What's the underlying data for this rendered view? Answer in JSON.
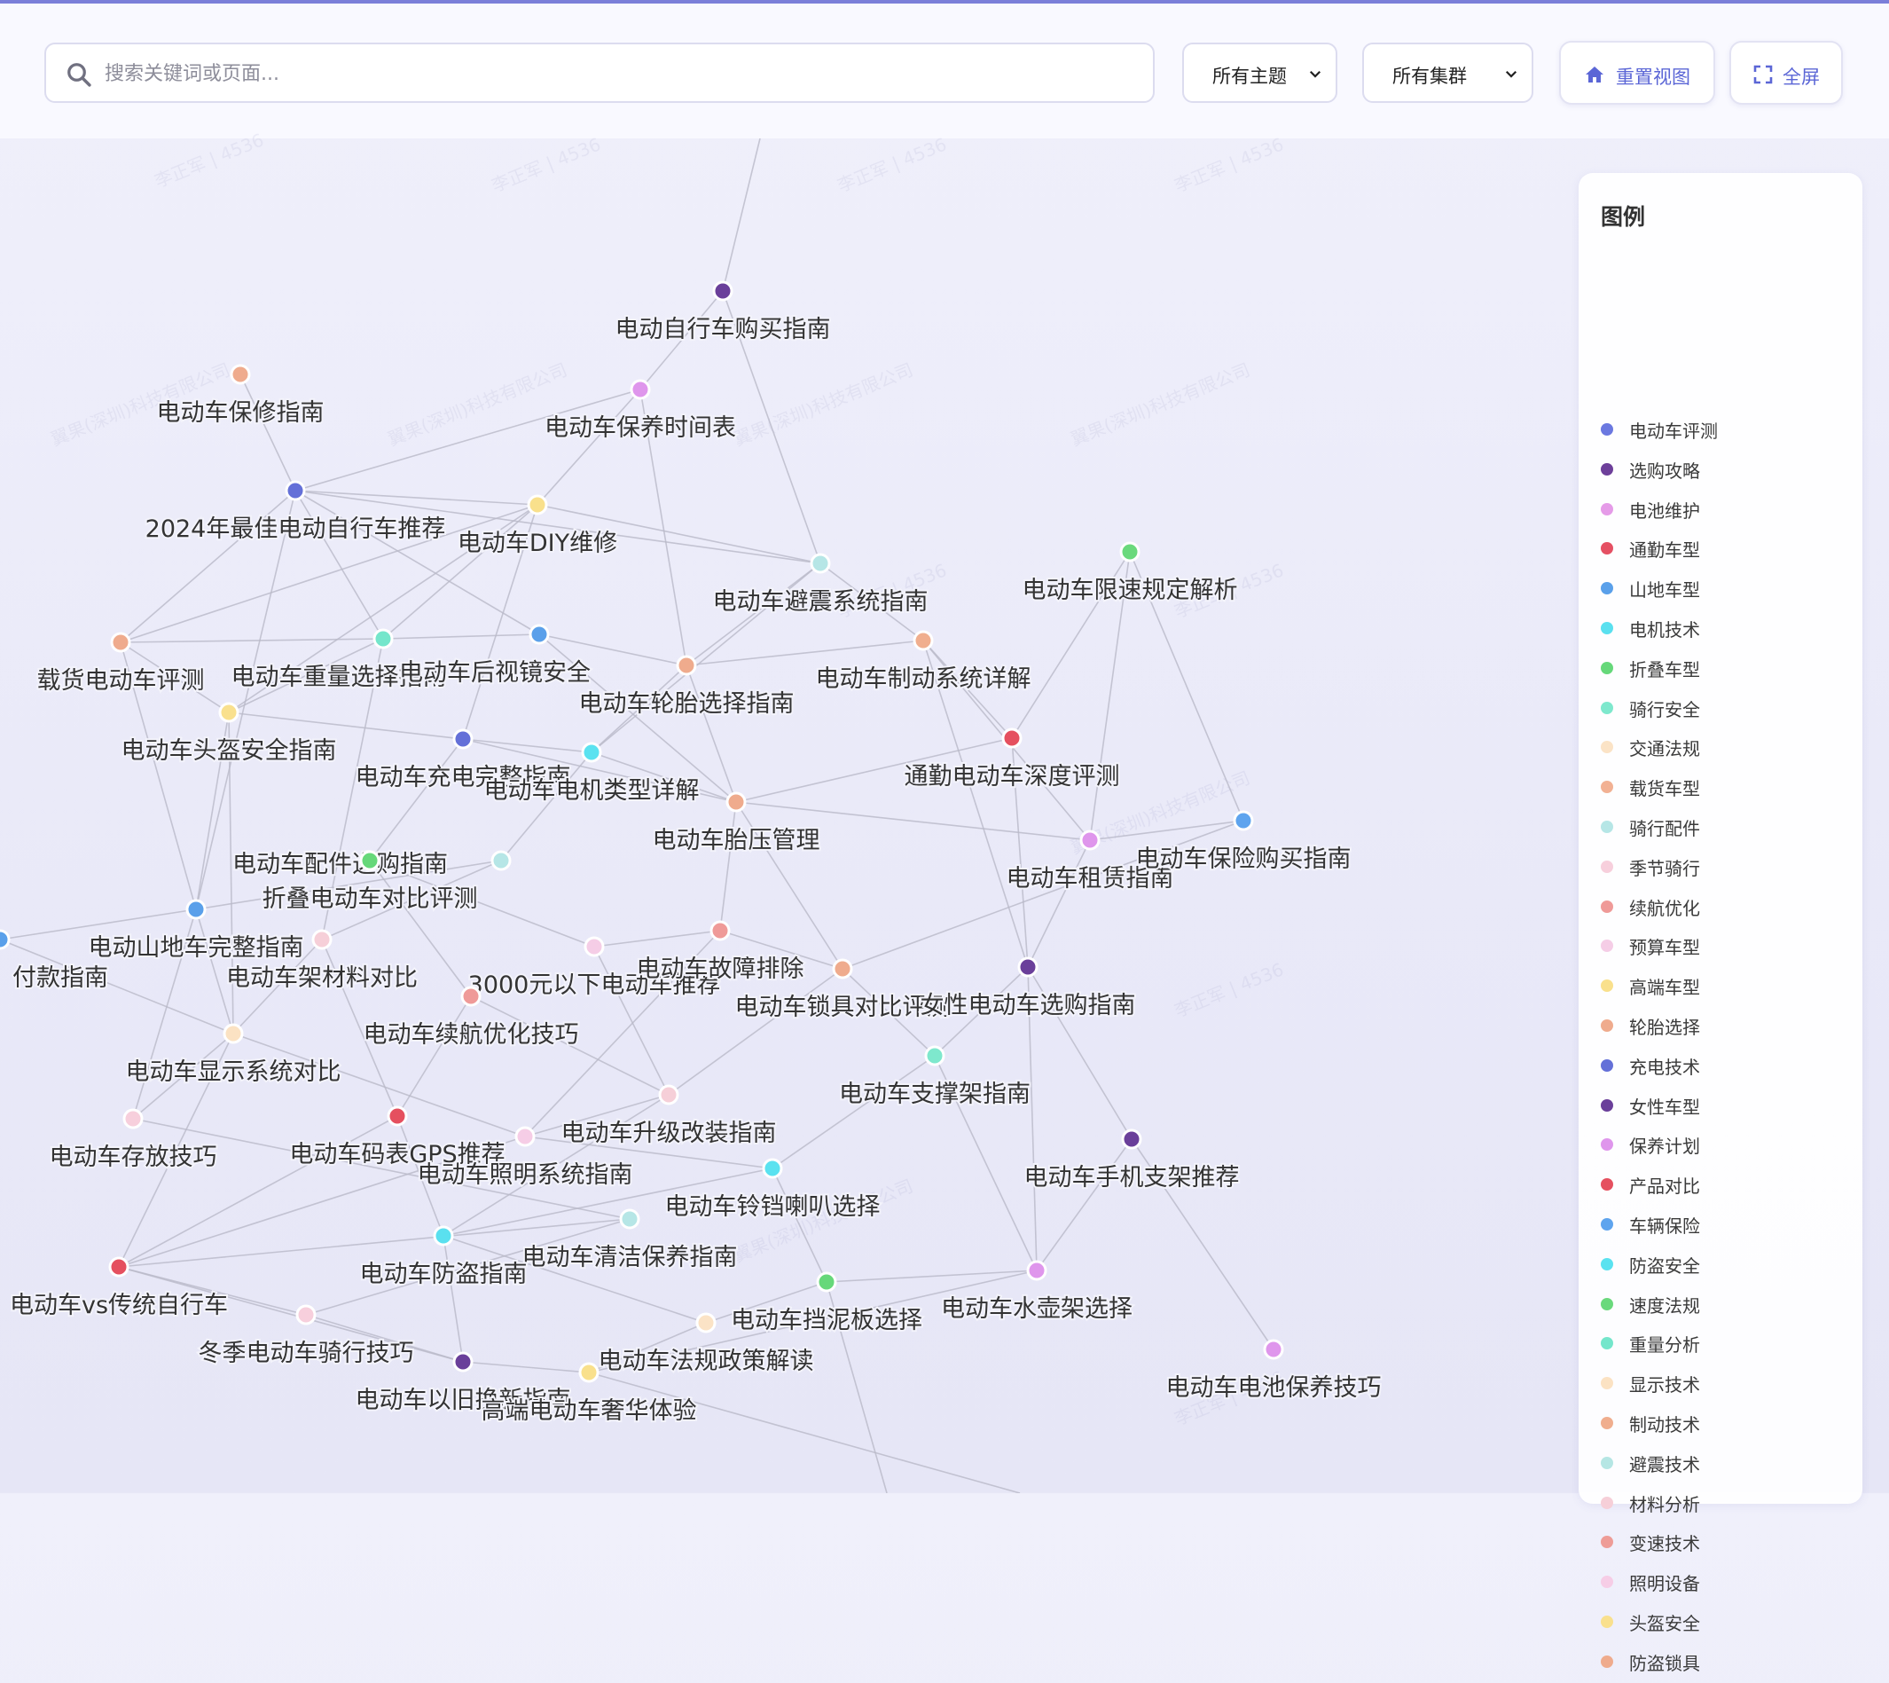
{
  "toolbar": {
    "search_placeholder": "搜索关键词或页面...",
    "topic_select": "所有主题",
    "cluster_select": "所有集群",
    "reset_label": "重置视图",
    "fullscreen_label": "全屏",
    "accent_color": "#5b66d6"
  },
  "legend": {
    "title": "图例",
    "items": [
      {
        "label": "电动车评测",
        "color": "#6b78e0"
      },
      {
        "label": "选购攻略",
        "color": "#6d3f9a"
      },
      {
        "label": "电池维护",
        "color": "#e59be8"
      },
      {
        "label": "通勤车型",
        "color": "#e55063"
      },
      {
        "label": "山地车型",
        "color": "#5aa0ea"
      },
      {
        "label": "电机技术",
        "color": "#5ae0ef"
      },
      {
        "label": "折叠车型",
        "color": "#66d87a"
      },
      {
        "label": "骑行安全",
        "color": "#7ee8cd"
      },
      {
        "label": "交通法规",
        "color": "#fbe3c6"
      },
      {
        "label": "载货车型",
        "color": "#f2b193"
      },
      {
        "label": "骑行配件",
        "color": "#b6e6e6"
      },
      {
        "label": "季节骑行",
        "color": "#f7cfdc"
      },
      {
        "label": "续航优化",
        "color": "#ef9a98"
      },
      {
        "label": "预算车型",
        "color": "#f5cde6"
      },
      {
        "label": "高端车型",
        "color": "#f9e08c"
      },
      {
        "label": "轮胎选择",
        "color": "#efab8d"
      },
      {
        "label": "充电技术",
        "color": "#6470d8"
      },
      {
        "label": "女性车型",
        "color": "#6a3f9a"
      },
      {
        "label": "保养计划",
        "color": "#df96ec"
      },
      {
        "label": "产品对比",
        "color": "#e5505f"
      },
      {
        "label": "车辆保险",
        "color": "#5ea4ee"
      },
      {
        "label": "防盗安全",
        "color": "#5ae2f0"
      },
      {
        "label": "速度法规",
        "color": "#6ad97c"
      },
      {
        "label": "重量分析",
        "color": "#74e6cb"
      },
      {
        "label": "显示技术",
        "color": "#fbe2c3"
      },
      {
        "label": "制动技术",
        "color": "#f0ae8e"
      },
      {
        "label": "避震技术",
        "color": "#b5e6e4"
      },
      {
        "label": "材料分析",
        "color": "#f6cfd8"
      },
      {
        "label": "变速技术",
        "color": "#ee9c97"
      },
      {
        "label": "照明设备",
        "color": "#f6cde6"
      },
      {
        "label": "头盔安全",
        "color": "#f9e08e"
      },
      {
        "label": "防盗锁具",
        "color": "#efab8d"
      }
    ]
  },
  "graph": {
    "nodes": [
      {
        "label": "电动自行车购买指南",
        "color": "#6a3f9a"
      },
      {
        "label": "电动车保修指南",
        "color": "#efab8d"
      },
      {
        "label": "电动车保养时间表",
        "color": "#df96ec"
      },
      {
        "label": "2024年最佳电动自行车推荐",
        "color": "#6470d8"
      },
      {
        "label": "电动车DIY维修",
        "color": "#f9e08c"
      },
      {
        "label": "电动车避震系统指南",
        "color": "#b6e6e6"
      },
      {
        "label": "电动车限速规定解析",
        "color": "#6ad97c"
      },
      {
        "label": "载货电动车评测",
        "color": "#efab8d"
      },
      {
        "label": "电动车重量选择指南",
        "color": "#74e6cb"
      },
      {
        "label": "电动车后视镜安全",
        "color": "#5aa0ea"
      },
      {
        "label": "电动车轮胎选择指南",
        "color": "#efab8d"
      },
      {
        "label": "电动车制动系统详解",
        "color": "#f0ae8e"
      },
      {
        "label": "电动车头盔安全指南",
        "color": "#f9e08e"
      },
      {
        "label": "电动车充电完整指南",
        "color": "#6470d8"
      },
      {
        "label": "电动车电机类型详解",
        "color": "#5ae2f0"
      },
      {
        "label": "通勤电动车深度评测",
        "color": "#e5505f"
      },
      {
        "label": "电动车胎压管理",
        "color": "#efab8d"
      },
      {
        "label": "电动车配件选购指南",
        "color": "#b6e6e6"
      },
      {
        "label": "折叠电动车对比评测",
        "color": "#66d87a"
      },
      {
        "label": "电动车租赁指南",
        "color": "#df96ec"
      },
      {
        "label": "电动车保险购买指南",
        "color": "#5ea4ee"
      },
      {
        "label": "电动山地车完整指南",
        "color": "#5aa0ea"
      },
      {
        "label": "电动车架材料对比",
        "color": "#f6cfd8"
      },
      {
        "label": "3000元以下电动车推荐",
        "color": "#f5cde6"
      },
      {
        "label": "电动车故障排除",
        "color": "#ef9a98"
      },
      {
        "label": "电动车锁具对比评测",
        "color": "#efab8d"
      },
      {
        "label": "女性电动车选购指南",
        "color": "#6a3f9a"
      },
      {
        "label": "付款指南",
        "color": "#5aa0ea"
      },
      {
        "label": "电动车续航优化技巧",
        "color": "#ef9a98"
      },
      {
        "label": "电动车显示系统对比",
        "color": "#fbe2c3"
      },
      {
        "label": "电动车支撑架指南",
        "color": "#7ee8cd"
      },
      {
        "label": "电动车升级改装指南",
        "color": "#f6cfd8"
      },
      {
        "label": "电动车存放技巧",
        "color": "#f7cfdc"
      },
      {
        "label": "电动车码表GPS推荐",
        "color": "#e5505f"
      },
      {
        "label": "电动车照明系统指南",
        "color": "#f6cde6"
      },
      {
        "label": "电动车手机支架推荐",
        "color": "#6a3f9a"
      },
      {
        "label": "电动车铃铛喇叭选择",
        "color": "#5ae2f0"
      },
      {
        "label": "电动车清洁保养指南",
        "color": "#b6e6e6"
      },
      {
        "label": "电动车vs传统自行车",
        "color": "#e5505f"
      },
      {
        "label": "电动车防盗指南",
        "color": "#5ae0ef"
      },
      {
        "label": "电动车挡泥板选择",
        "color": "#66d87a"
      },
      {
        "label": "电动车水壶架选择",
        "color": "#df96ec"
      },
      {
        "label": "冬季电动车骑行技巧",
        "color": "#f7cfdc"
      },
      {
        "label": "电动车法规政策解读",
        "color": "#fbe3c6"
      },
      {
        "label": "电动车以旧换新指南",
        "color": "#6a3f9a"
      },
      {
        "label": "高端电动车奢华体验",
        "color": "#f9e08c"
      },
      {
        "label": "电动车电池保养技巧",
        "color": "#df96ec"
      }
    ]
  }
}
